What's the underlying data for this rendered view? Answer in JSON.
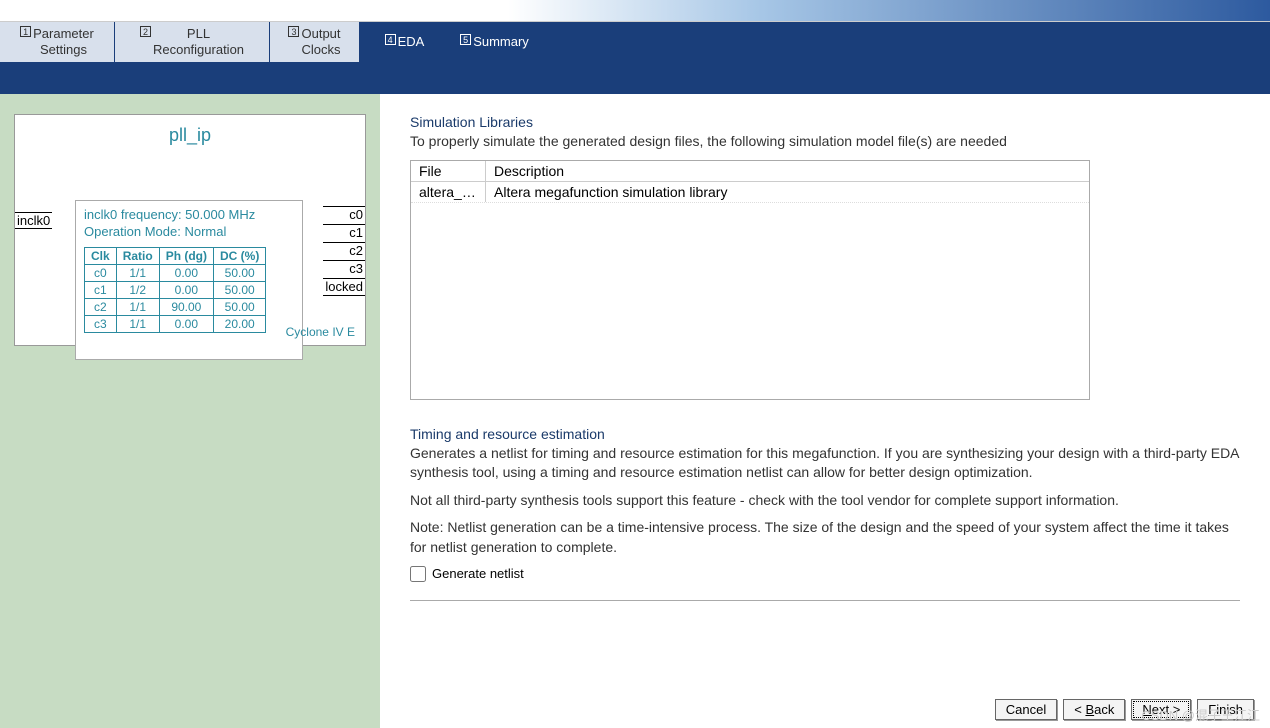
{
  "tabs": [
    {
      "num": "1",
      "label": "Parameter\nSettings"
    },
    {
      "num": "2",
      "label": "PLL\nReconfiguration"
    },
    {
      "num": "3",
      "label": "Output\nClocks"
    },
    {
      "num": "4",
      "label": "EDA"
    },
    {
      "num": "5",
      "label": "Summary"
    }
  ],
  "block": {
    "title": "pll_ip",
    "port_in": "inclk0",
    "info_freq": "inclk0 frequency: 50.000 MHz",
    "info_mode": "Operation Mode: Normal",
    "clk_headers": [
      "Clk",
      "Ratio",
      "Ph (dg)",
      "DC (%)"
    ],
    "clk_rows": [
      [
        "c0",
        "1/1",
        "0.00",
        "50.00"
      ],
      [
        "c1",
        "1/2",
        "0.00",
        "50.00"
      ],
      [
        "c2",
        "1/1",
        "90.00",
        "50.00"
      ],
      [
        "c3",
        "1/1",
        "0.00",
        "20.00"
      ]
    ],
    "ports_out": [
      "c0",
      "c1",
      "c2",
      "c3",
      "locked"
    ],
    "device": "Cyclone IV E"
  },
  "sim": {
    "title": "Simulation Libraries",
    "desc": "To properly simulate the generated design files, the following simulation model file(s) are needed",
    "col_file": "File",
    "col_desc": "Description",
    "rows": [
      {
        "file": "altera_mf",
        "desc": "Altera megafunction simulation library"
      }
    ]
  },
  "timing": {
    "title": "Timing and resource estimation",
    "p1": "Generates a netlist for timing and resource estimation for this megafunction. If you are synthesizing your design with a third-party EDA synthesis tool, using a timing and resource estimation netlist can allow for better design optimization.",
    "p2": "Not all third-party synthesis tools support this feature - check with the tool vendor for complete support information.",
    "p3": "Note: Netlist generation can be a time-intensive process. The size of the design and the speed of your system affect the time it takes for netlist generation to complete.",
    "checkbox_label": "Generate netlist"
  },
  "buttons": {
    "cancel": "Cancel",
    "back": "< Back",
    "next": "Next >",
    "finish": "Finish"
  },
  "watermark": "CSDN @混子王江江"
}
